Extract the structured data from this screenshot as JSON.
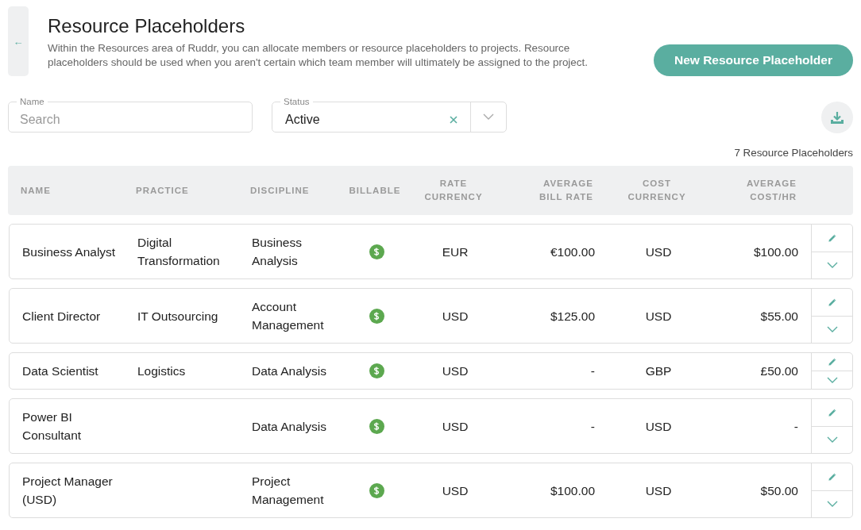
{
  "back_button": {
    "icon": "←"
  },
  "title": "Resource Placeholders",
  "description": "Within the Resources area of Ruddr, you can allocate members or resource placeholders to projects. Resource placeholders should be used when you aren't certain which team member will ultimately be assigned to the project.",
  "new_button": "New Resource Placeholder",
  "filters": {
    "name": {
      "label": "Name",
      "placeholder": "Search"
    },
    "status": {
      "label": "Status",
      "value": "Active"
    }
  },
  "count": "7 Resource Placeholders",
  "table": {
    "columns": [
      "NAME",
      "PRACTICE",
      "DISCIPLINE",
      "BILLABLE",
      "RATE CURRENCY",
      "AVERAGE BILL RATE",
      "COST CURRENCY",
      "AVERAGE COST/HR"
    ],
    "rows": [
      {
        "name": "Business Analyst",
        "practice": "Digital Transformation",
        "discipline": "Business Analysis",
        "billable": true,
        "rate_currency": "EUR",
        "average_bill_rate": "€100.00",
        "cost_currency": "USD",
        "average_cost_hr": "$100.00"
      },
      {
        "name": "Client Director",
        "practice": "IT Outsourcing",
        "discipline": "Account Management",
        "billable": true,
        "rate_currency": "USD",
        "average_bill_rate": "$125.00",
        "cost_currency": "USD",
        "average_cost_hr": "$55.00"
      },
      {
        "name": "Data Scientist",
        "practice": "Logistics",
        "discipline": "Data Analysis",
        "billable": true,
        "rate_currency": "USD",
        "average_bill_rate": "-",
        "cost_currency": "GBP",
        "average_cost_hr": "£50.00"
      },
      {
        "name": "Power BI Consultant",
        "discipline": "Data Analysis",
        "billable": true,
        "rate_currency": "USD",
        "average_bill_rate": "-",
        "cost_currency": "USD",
        "average_cost_hr": "-"
      },
      {
        "name": "Project Manager (USD)",
        "discipline": "Project Management",
        "billable": true,
        "rate_currency": "USD",
        "average_bill_rate": "$100.00",
        "cost_currency": "USD",
        "average_cost_hr": "$50.00"
      }
    ]
  }
}
